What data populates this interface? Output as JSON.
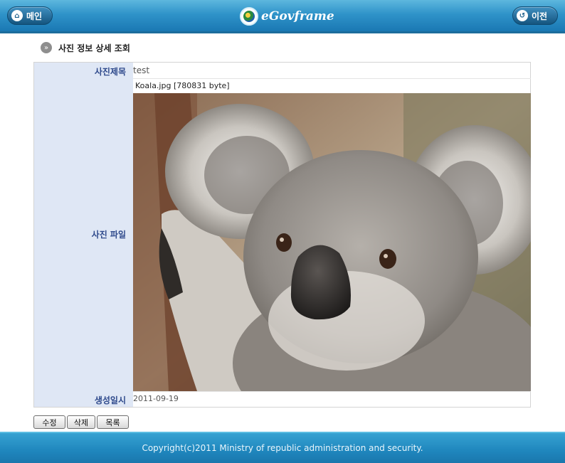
{
  "header": {
    "home_label": "메인",
    "prev_label": "이전",
    "logo_text": "eGovframe",
    "home_icon": "home-icon",
    "prev_icon": "back-icon"
  },
  "page": {
    "title": "사진 정보 상세 조회",
    "title_icon": "arrow-right-icon"
  },
  "detail": {
    "title_label": "사진제목",
    "title_value": "test",
    "file_label": "사진 파일",
    "file_name": "Koala.jpg [780831 byte]",
    "date_label": "생성일시",
    "date_value": "2011-09-19"
  },
  "actions": {
    "edit": "수정",
    "delete": "삭제",
    "list": "목록"
  },
  "footer": {
    "copyright": "Copyright(c)2011 Ministry of republic administration and security."
  },
  "colors": {
    "header_blue": "#2f93c9",
    "label_bg": "#dfe7f5",
    "label_text": "#2f4a8c"
  }
}
